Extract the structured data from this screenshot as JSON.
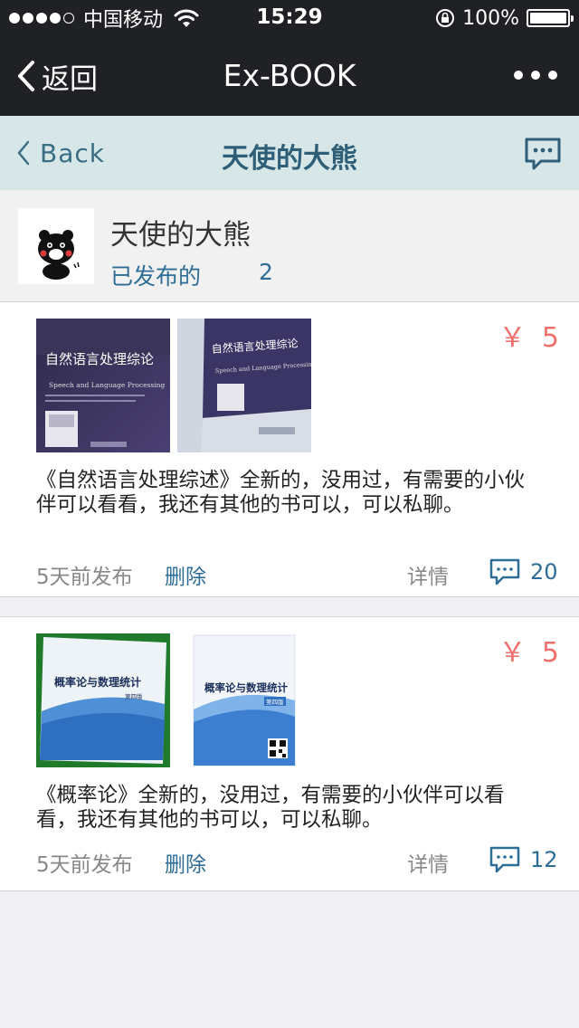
{
  "status_bar": {
    "carrier": "中国移动",
    "time": "15:29",
    "battery": "100%",
    "battery_level": 1.0,
    "signal_bars": 4
  },
  "nav": {
    "back_label": "返回",
    "title": "Ex-BOOK"
  },
  "app_header": {
    "back_label": "Back",
    "title": "天使的大熊"
  },
  "profile": {
    "name": "天使的大熊",
    "published_label": "已发布的",
    "published_count": "2"
  },
  "posts": [
    {
      "price": "￥ 5",
      "description": "  《自然语言处理综述》全新的，没用过，有需要的小伙伴可以看看，我还有其他的书可以，可以私聊。",
      "time": "5天前发布",
      "delete_label": "删除",
      "detail_label": "详情",
      "comment_count": "20",
      "images": [
        {
          "cover_title": "自然语言处理综论",
          "cover_subtitle": "Speech and Language Processing"
        },
        {
          "cover_title": "自然语言处理综论",
          "cover_subtitle": "Speech and Language Processing"
        }
      ]
    },
    {
      "price": "￥ 5",
      "description": "《概率论》全新的，没用过，有需要的小伙伴可以看看，我还有其他的书可以，可以私聊。",
      "time": "5天前发布",
      "delete_label": "删除",
      "detail_label": "详情",
      "comment_count": "12",
      "images": [
        {
          "cover_title": "概率论与数理统计",
          "cover_subtitle": "第四版"
        },
        {
          "cover_title": "概率论与数理统计",
          "cover_subtitle": "第四版"
        }
      ]
    }
  ],
  "colors": {
    "dark_bar": "#202124",
    "header_bg": "#d7e6e6",
    "accent_blue": "#2e6d96",
    "price_red": "#f0706e"
  }
}
